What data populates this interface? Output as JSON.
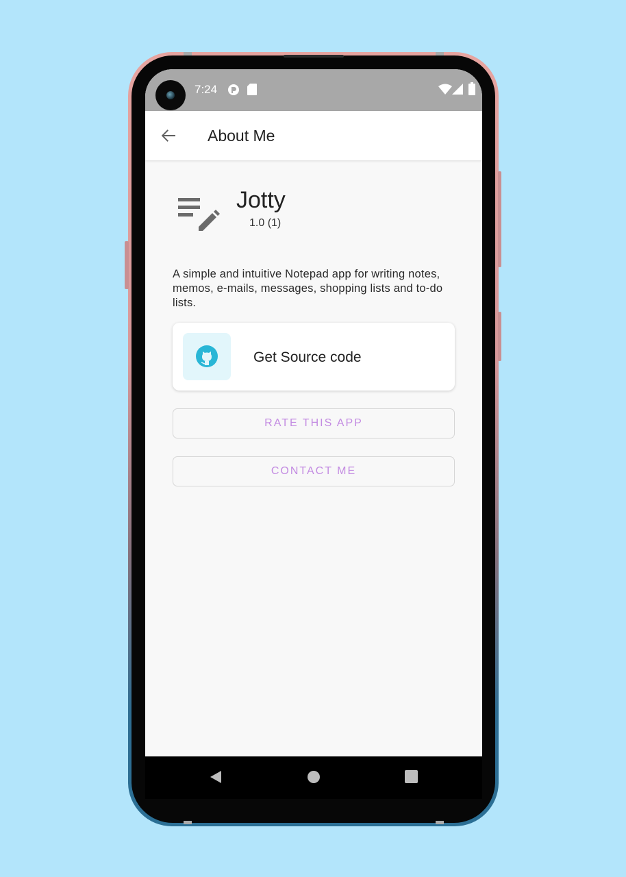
{
  "status_bar": {
    "time": "7:24",
    "icons": [
      "app-notification-icon",
      "sd-card-icon",
      "wifi-icon",
      "signal-icon",
      "battery-icon"
    ]
  },
  "app_bar": {
    "title": "About Me",
    "back_icon": "arrow-back-icon"
  },
  "app_info": {
    "name": "Jotty",
    "version": "1.0 (1)",
    "logo_icon": "notes-edit-icon",
    "description": "A simple and intuitive Notepad app for writing notes, memos, e-mails, messages, shopping lists and to-do lists."
  },
  "source_card": {
    "label": "Get Source code",
    "icon": "github-icon"
  },
  "buttons": {
    "rate_label": "RATE THIS APP",
    "contact_label": "CONTACT ME"
  },
  "nav_bar": {
    "icons": [
      "back-triangle-icon",
      "home-circle-icon",
      "recents-square-icon"
    ]
  },
  "colors": {
    "background": "#b3e5fb",
    "status_bar": "#a8a8a8",
    "accent_text": "#c38be2",
    "github_icon": "#29b6d6",
    "icon_box": "#e2f6fb"
  }
}
